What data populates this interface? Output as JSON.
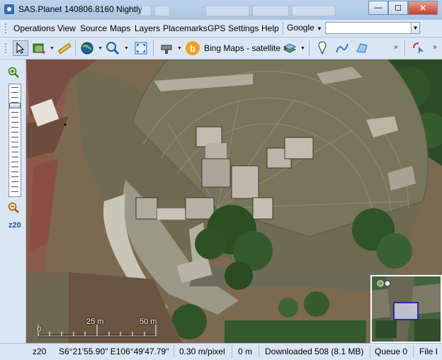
{
  "window": {
    "title": "SAS.Planet 140806.8160 Nightly",
    "controls": {
      "minimize": "—",
      "maximize": "☐",
      "close": "✕"
    }
  },
  "menu": {
    "items": [
      "Operations",
      "View",
      "Source",
      "Maps",
      "Layers",
      "Placemarks",
      "GPS",
      "Settings",
      "Help"
    ],
    "search_provider": "Google",
    "search_value": ""
  },
  "toolbar": {
    "map_source": "Bing Maps - satellite",
    "icons": [
      "select-arrow-icon",
      "layers-move-icon",
      "ruler-icon",
      "globe-icon",
      "zoom-icon",
      "fullscreen-icon",
      "satellite-icon",
      "bing-icon",
      "layers-icon",
      "placemark-icon",
      "path-icon",
      "polygon-icon",
      "gps-icon"
    ],
    "overflow": "»"
  },
  "left_panel": {
    "zoom_level": "z20",
    "zoom_slider_fraction": 0.17
  },
  "map": {
    "scale_labels": [
      "0",
      "25 m",
      "50 m"
    ]
  },
  "status": {
    "zoom": "z20",
    "coords": "S6°21'55.90\" E106°49'47.79\"",
    "resolution": "0.30 m/pixel",
    "altitude": "0 m",
    "downloaded": "Downloaded 508 (8.1 MB)",
    "queue": "Queue 0",
    "file": "File I"
  },
  "colors": {
    "chrome": "#dbe6f4",
    "titlebar": "#bcd3ea",
    "close_button": "#c7412a",
    "zoom_text": "#1a55a8"
  }
}
